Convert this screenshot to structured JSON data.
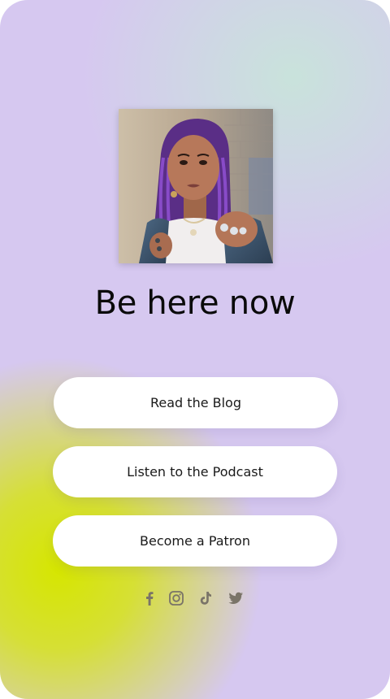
{
  "profile": {
    "title": "Be here now",
    "photo_icon": "portrait-photo"
  },
  "links": [
    {
      "label": "Read the Blog"
    },
    {
      "label": "Listen to the Podcast"
    },
    {
      "label": "Become a Patron"
    }
  ],
  "socials": [
    {
      "name": "facebook-icon"
    },
    {
      "name": "instagram-icon"
    },
    {
      "name": "tiktok-icon"
    },
    {
      "name": "twitter-icon"
    }
  ],
  "colors": {
    "background": "#d6c8f0",
    "accent_lime": "#d6e600",
    "accent_mint": "#c8e4da",
    "button": "#ffffff",
    "text": "#0a0a0a",
    "icon": "#7a7468"
  }
}
